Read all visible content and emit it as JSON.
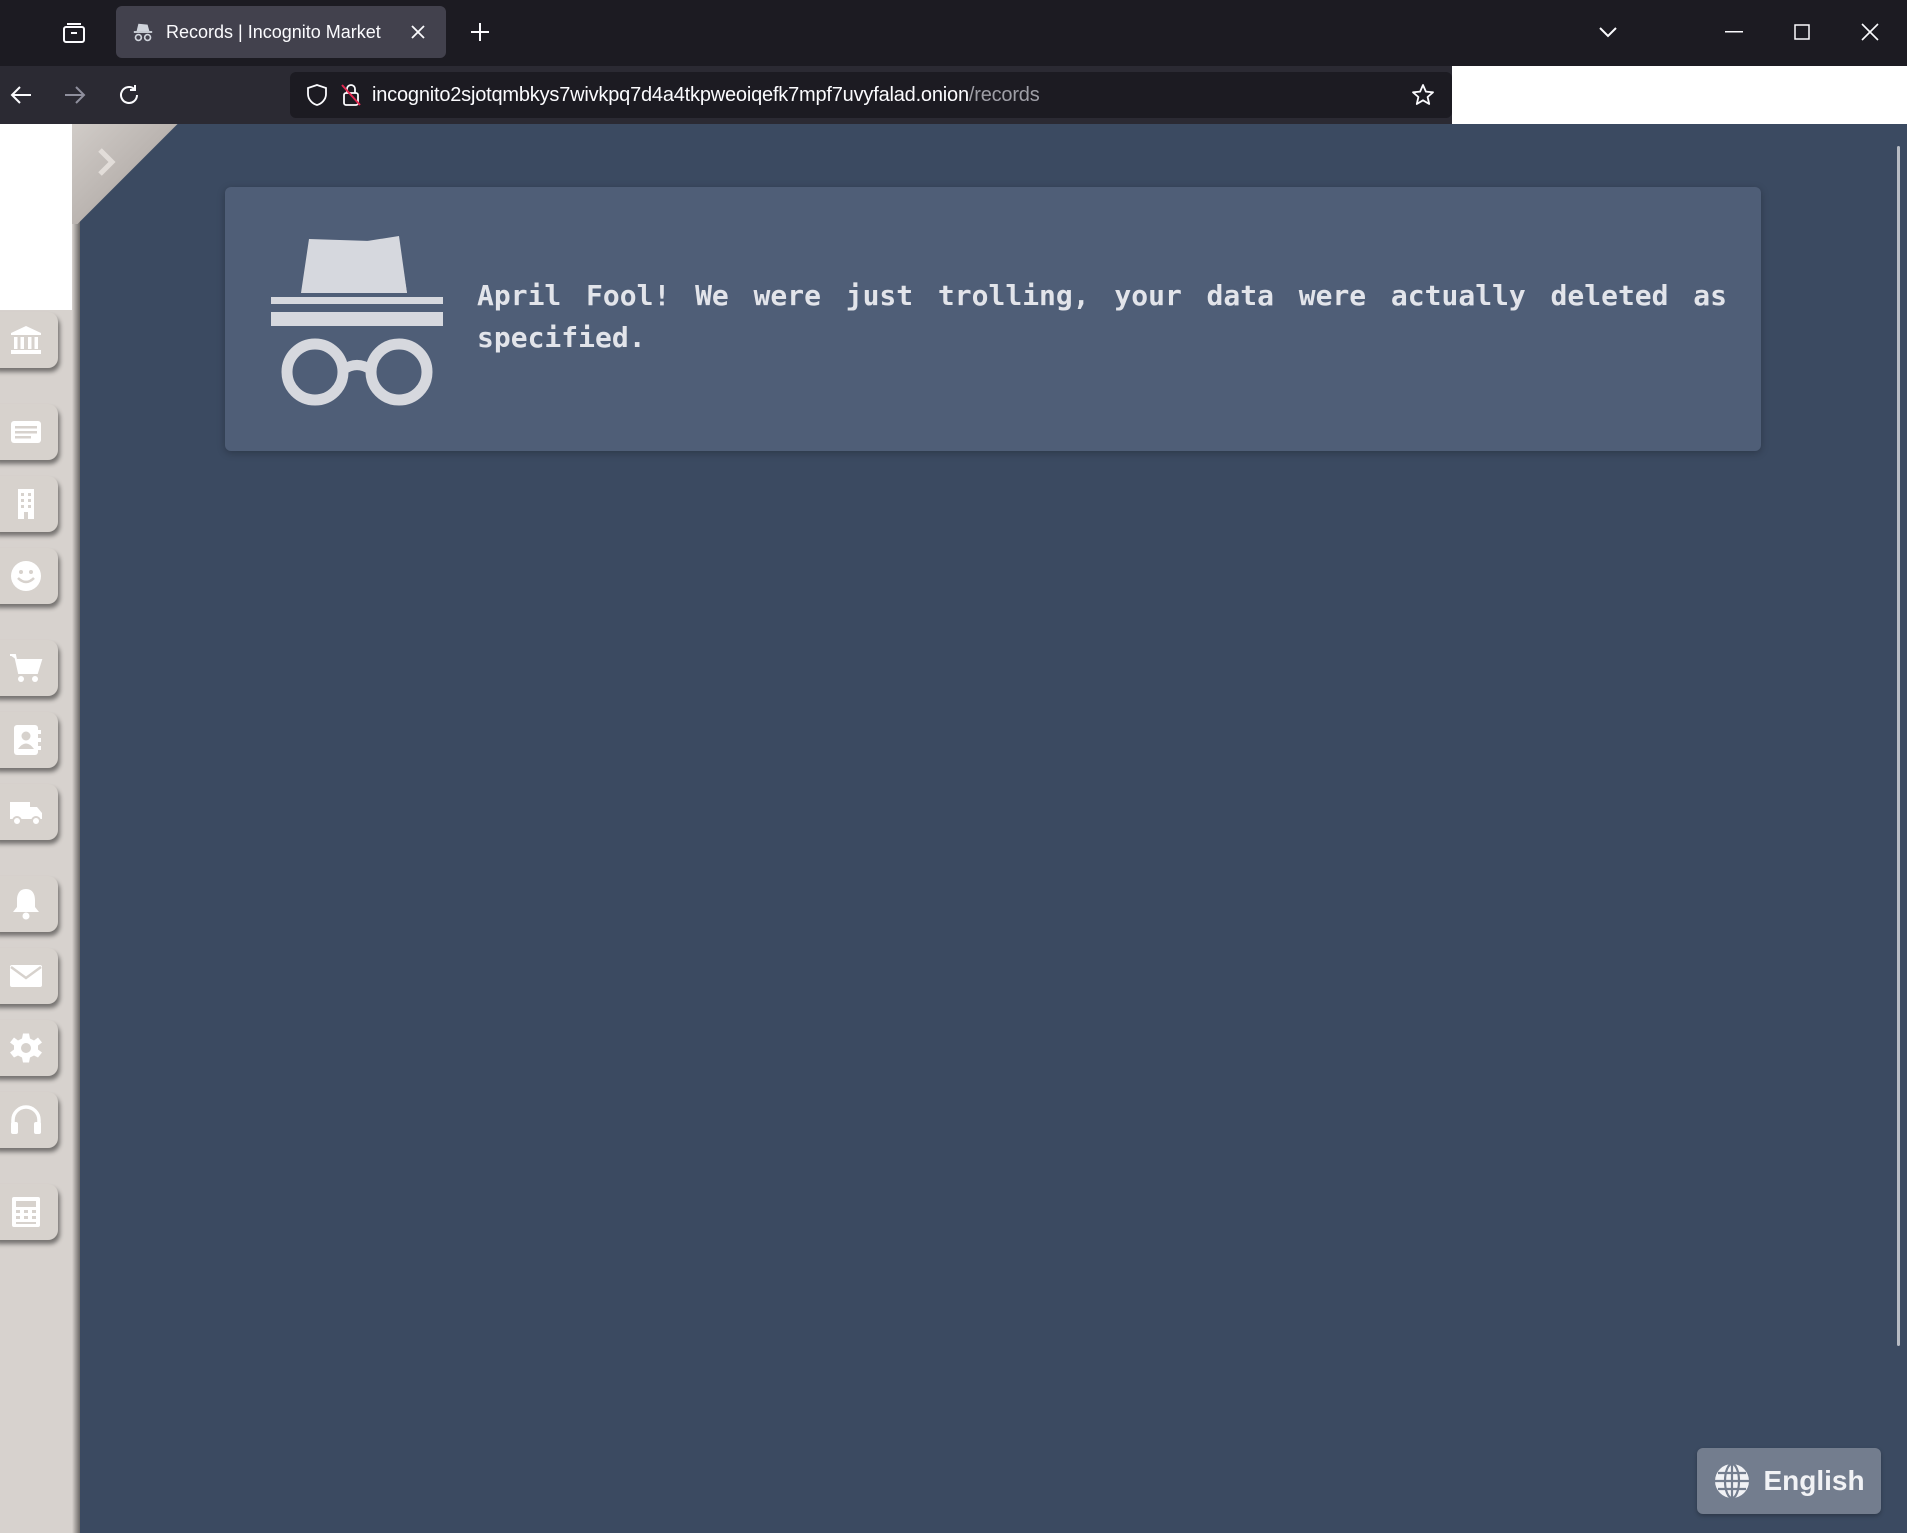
{
  "browser": {
    "tab_title": "Records | Incognito Market",
    "url_host": "incognito2sjotqmbkys7wivkpq7d4a4tkpweoiqefk7mpf7uvyfalad.onion",
    "url_path": "/records"
  },
  "sidebar": {
    "items": [
      {
        "icon": "bank-icon"
      },
      {
        "icon": "listing-icon"
      },
      {
        "icon": "building-icon"
      },
      {
        "icon": "smiley-icon"
      },
      {
        "icon": "cart-icon"
      },
      {
        "icon": "contact-book-icon"
      },
      {
        "icon": "truck-icon"
      },
      {
        "icon": "bell-icon"
      },
      {
        "icon": "envelope-icon"
      },
      {
        "icon": "gear-icon"
      },
      {
        "icon": "headset-icon"
      },
      {
        "icon": "calculator-icon"
      }
    ]
  },
  "main": {
    "message": "April Fool! We were just trolling, your data were actually deleted as specified."
  },
  "language": {
    "label": "English"
  },
  "colors": {
    "page_bg": "#3b4a61",
    "panel_bg": "#4f5e77",
    "sidebar_bg": "#d7d2cd"
  }
}
